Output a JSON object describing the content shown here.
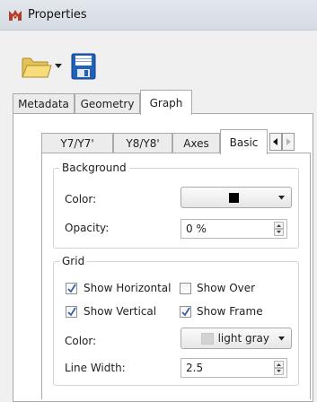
{
  "window": {
    "title": "Properties"
  },
  "outer_tabs": [
    "Metadata",
    "Geometry",
    "Graph"
  ],
  "outer_active_tab": "Graph",
  "inner_tabs": [
    "Y7/Y7'",
    "Y8/Y8'",
    "Axes",
    "Basic"
  ],
  "inner_active_tab": "Basic",
  "background": {
    "title": "Background",
    "color_label": "Color:",
    "color_value": "#000000",
    "opacity_label": "Opacity:",
    "opacity_value": "0 %"
  },
  "grid": {
    "title": "Grid",
    "show_horizontal": {
      "label": "Show Horizontal",
      "checked": true
    },
    "show_over": {
      "label": "Show Over",
      "checked": false
    },
    "show_vertical": {
      "label": "Show Vertical",
      "checked": true
    },
    "show_frame": {
      "label": "Show Frame",
      "checked": true
    },
    "color_label": "Color:",
    "color_value": "light gray",
    "line_width_label": "Line Width:",
    "line_width_value": "2.5"
  },
  "icons": {
    "app": "app-logo-icon",
    "open": "folder-open-icon",
    "save": "floppy-disk-icon"
  }
}
